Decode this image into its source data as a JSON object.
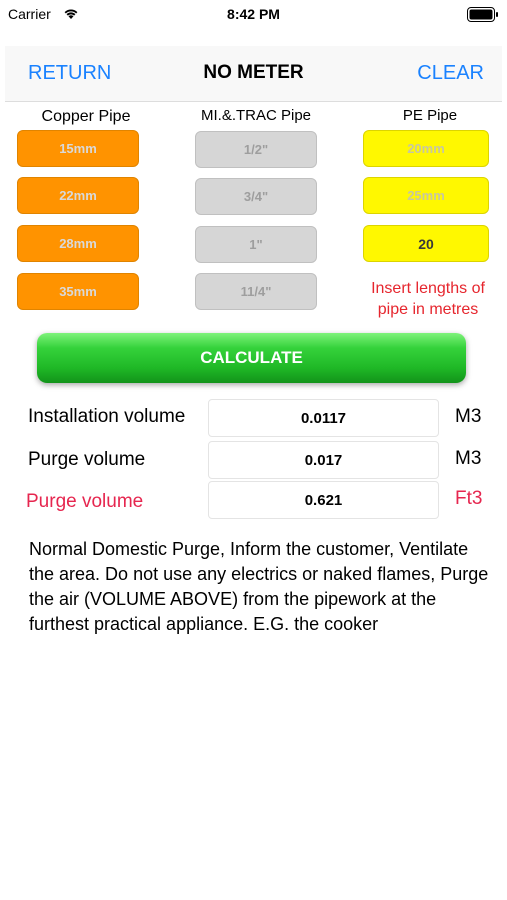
{
  "status_bar": {
    "carrier": "Carrier",
    "time": "8:42 PM",
    "wifi_icon": "wifi-icon",
    "battery_icon": "battery-icon"
  },
  "header": {
    "return_label": "RETURN",
    "title": "NO METER",
    "clear_label": "CLEAR"
  },
  "columns": {
    "copper": "Copper Pipe",
    "mi": "MI.&.TRAC Pipe",
    "pe": "PE Pipe"
  },
  "copper_fields": [
    {
      "placeholder": "15mm"
    },
    {
      "placeholder": "22mm"
    },
    {
      "placeholder": "28mm"
    },
    {
      "placeholder": "35mm"
    }
  ],
  "mi_fields": [
    {
      "placeholder": "1/2\""
    },
    {
      "placeholder": "3/4\""
    },
    {
      "placeholder": "1\""
    },
    {
      "placeholder": "11/4\""
    }
  ],
  "pe_fields": [
    {
      "placeholder": "20mm"
    },
    {
      "placeholder": "25mm"
    },
    {
      "value": "20"
    }
  ],
  "hint": "Insert lengths of pipe in metres",
  "calculate_label": "CALCULATE",
  "results": [
    {
      "label": "Installation volume",
      "value": "0.0117",
      "unit": "M3"
    },
    {
      "label": "Purge volume",
      "value": "0.017",
      "unit": "M3"
    },
    {
      "label": "Purge volume",
      "value": "0.621",
      "unit": "Ft3"
    }
  ],
  "note": "Normal Domestic Purge, Inform the customer, Ventilate the area. Do not use any electrics or naked flames, Purge the air (VOLUME ABOVE) from the pipework at the furthest practical appliance. E.G. the cooker",
  "colors": {
    "accent": "#1a82ff",
    "copper": "#ff9300",
    "mi": "#d6d6d6",
    "pe": "#fff800",
    "calculate": "#1fb826",
    "alert": "#e6264f"
  }
}
